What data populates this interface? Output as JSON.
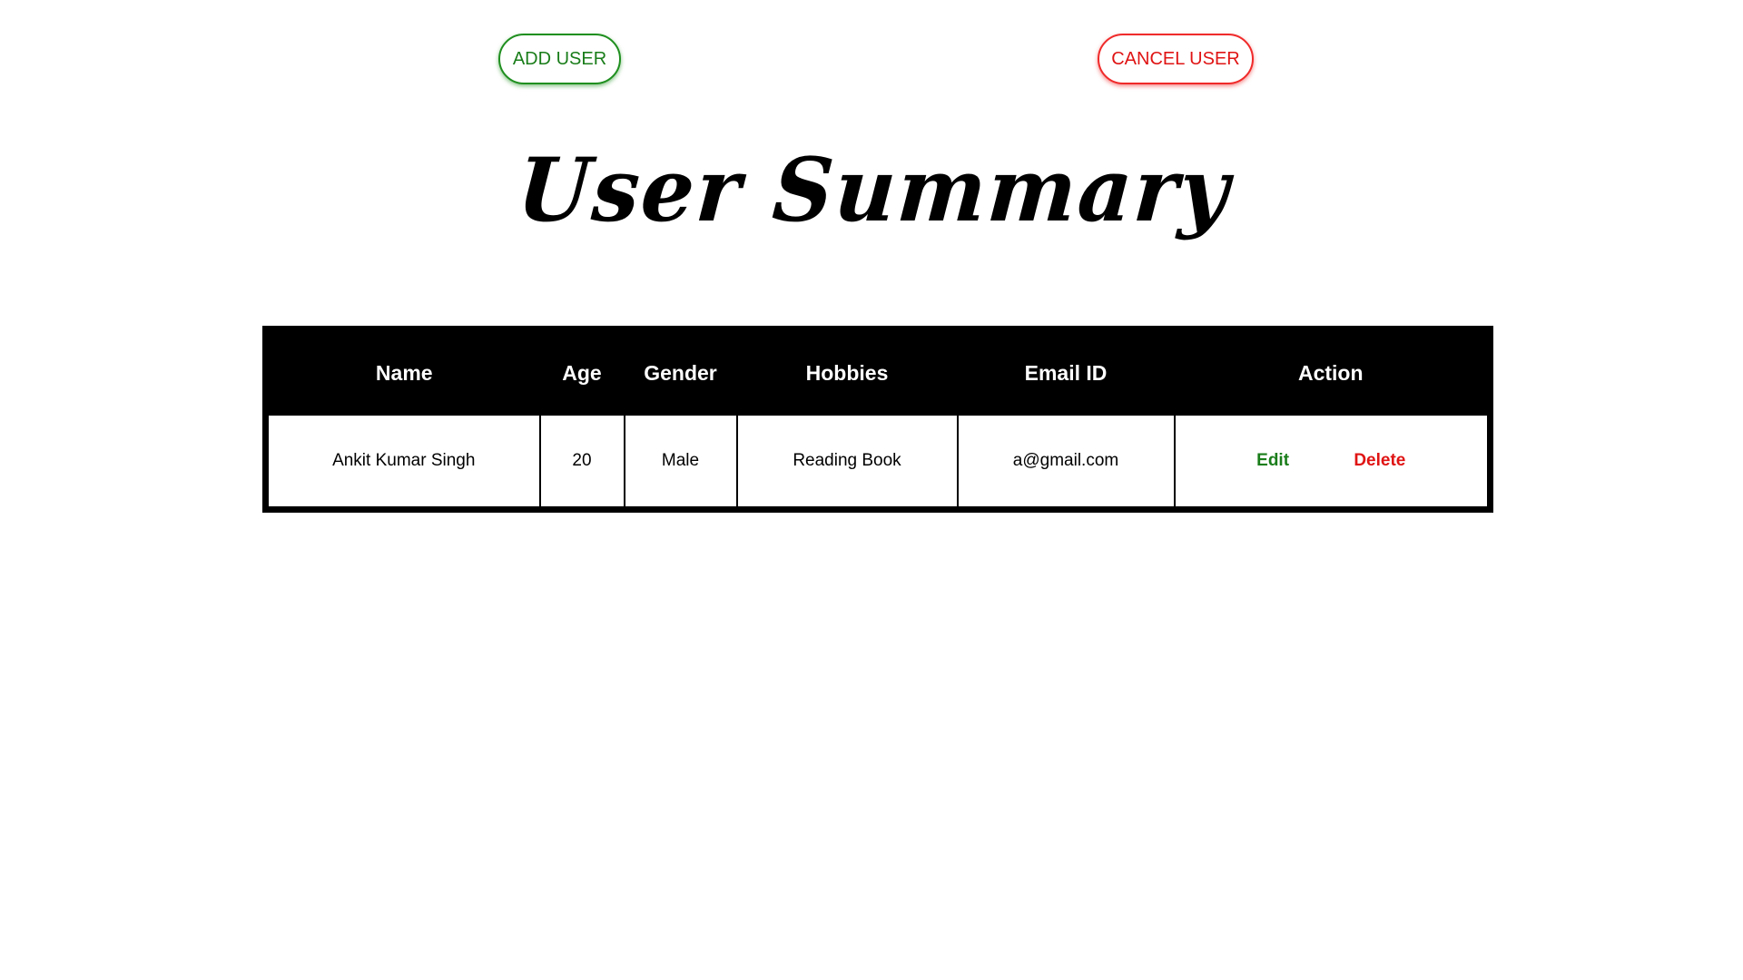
{
  "toolbar": {
    "add_user_label": "ADD USER",
    "cancel_user_label": "CANCEL USER"
  },
  "page": {
    "title": "User Summary"
  },
  "table": {
    "headers": [
      "Name",
      "Age",
      "Gender",
      "Hobbies",
      "Email ID",
      "Action"
    ],
    "rows": [
      {
        "name": "Ankit Kumar Singh",
        "age": "20",
        "gender": "Male",
        "hobbies": "Reading Book",
        "email": "a@gmail.com",
        "edit_label": "Edit",
        "delete_label": "Delete"
      }
    ]
  },
  "colors": {
    "add_accent": "#1f8f1f",
    "cancel_accent": "#f02a2a",
    "edit_text": "#1a7d1a",
    "delete_text": "#e01414",
    "header_bg": "#000000",
    "header_text": "#ffffff"
  }
}
